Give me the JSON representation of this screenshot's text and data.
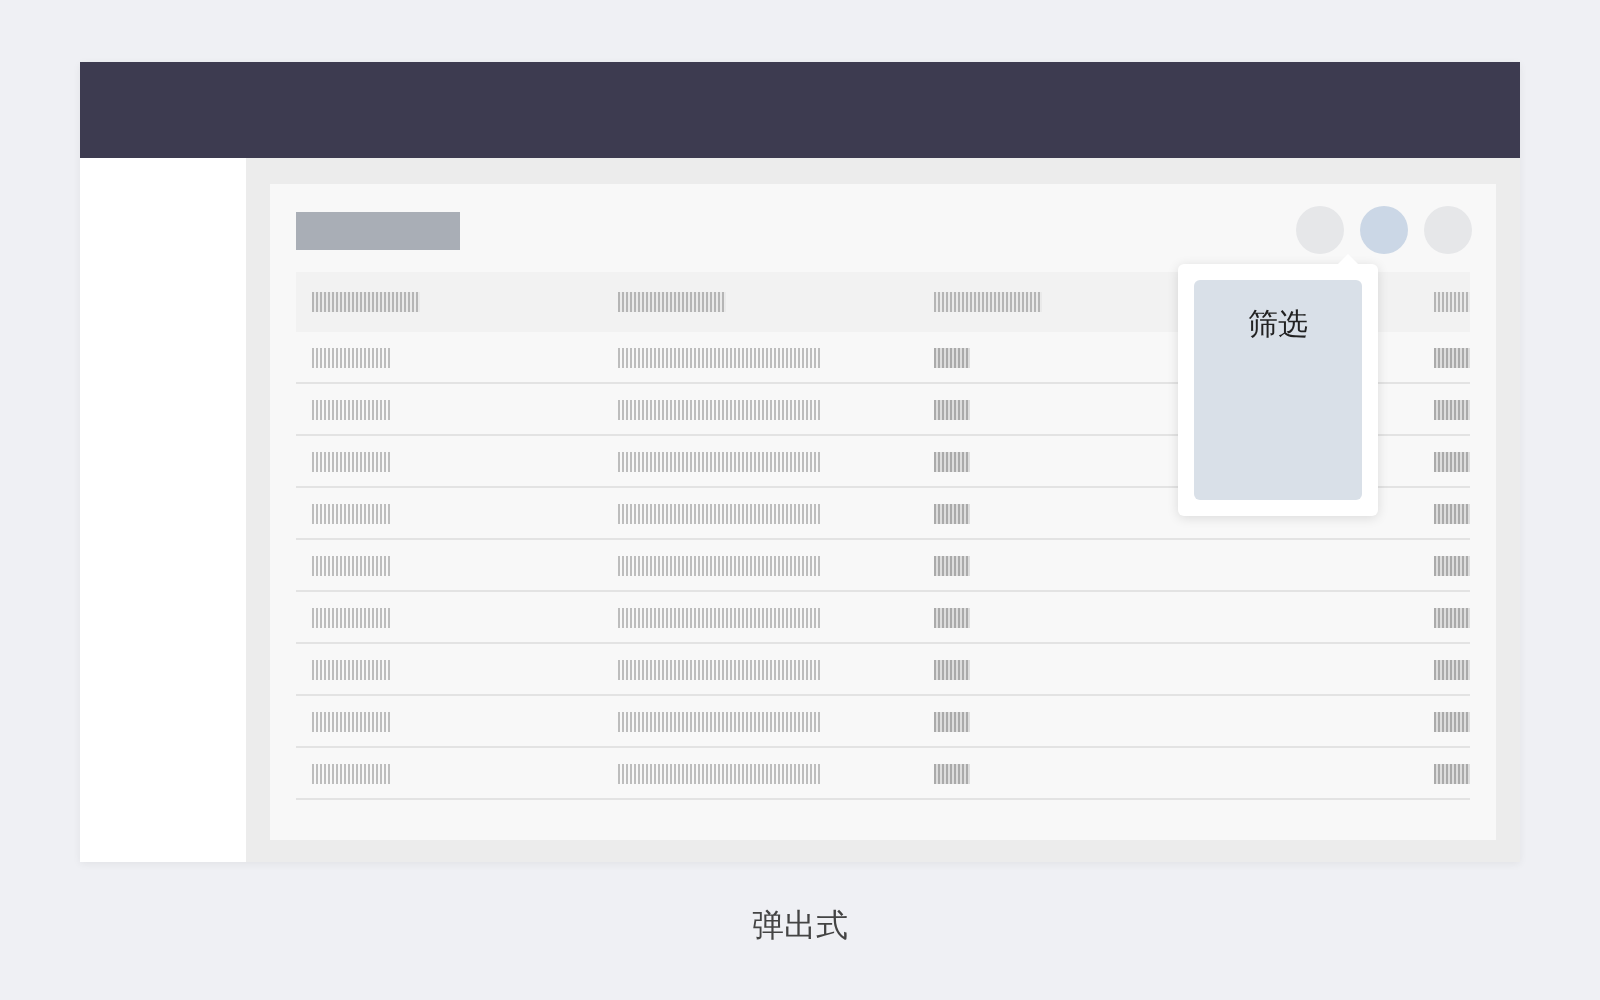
{
  "toolbar": {
    "buttons": [
      {
        "selected": false
      },
      {
        "selected": true
      },
      {
        "selected": false
      }
    ]
  },
  "popover": {
    "title": "筛选"
  },
  "caption": "弹出式"
}
